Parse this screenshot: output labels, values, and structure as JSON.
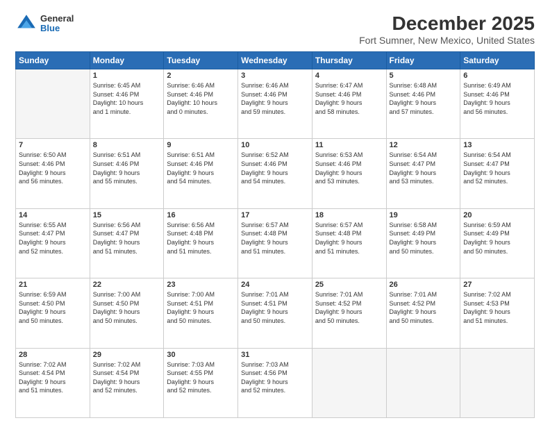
{
  "logo": {
    "general": "General",
    "blue": "Blue"
  },
  "title": "December 2025",
  "subtitle": "Fort Sumner, New Mexico, United States",
  "header": {
    "days": [
      "Sunday",
      "Monday",
      "Tuesday",
      "Wednesday",
      "Thursday",
      "Friday",
      "Saturday"
    ]
  },
  "weeks": [
    [
      {
        "day": "",
        "info": ""
      },
      {
        "day": "1",
        "info": "Sunrise: 6:45 AM\nSunset: 4:46 PM\nDaylight: 10 hours\nand 1 minute."
      },
      {
        "day": "2",
        "info": "Sunrise: 6:46 AM\nSunset: 4:46 PM\nDaylight: 10 hours\nand 0 minutes."
      },
      {
        "day": "3",
        "info": "Sunrise: 6:46 AM\nSunset: 4:46 PM\nDaylight: 9 hours\nand 59 minutes."
      },
      {
        "day": "4",
        "info": "Sunrise: 6:47 AM\nSunset: 4:46 PM\nDaylight: 9 hours\nand 58 minutes."
      },
      {
        "day": "5",
        "info": "Sunrise: 6:48 AM\nSunset: 4:46 PM\nDaylight: 9 hours\nand 57 minutes."
      },
      {
        "day": "6",
        "info": "Sunrise: 6:49 AM\nSunset: 4:46 PM\nDaylight: 9 hours\nand 56 minutes."
      }
    ],
    [
      {
        "day": "7",
        "info": "Sunrise: 6:50 AM\nSunset: 4:46 PM\nDaylight: 9 hours\nand 56 minutes."
      },
      {
        "day": "8",
        "info": "Sunrise: 6:51 AM\nSunset: 4:46 PM\nDaylight: 9 hours\nand 55 minutes."
      },
      {
        "day": "9",
        "info": "Sunrise: 6:51 AM\nSunset: 4:46 PM\nDaylight: 9 hours\nand 54 minutes."
      },
      {
        "day": "10",
        "info": "Sunrise: 6:52 AM\nSunset: 4:46 PM\nDaylight: 9 hours\nand 54 minutes."
      },
      {
        "day": "11",
        "info": "Sunrise: 6:53 AM\nSunset: 4:46 PM\nDaylight: 9 hours\nand 53 minutes."
      },
      {
        "day": "12",
        "info": "Sunrise: 6:54 AM\nSunset: 4:47 PM\nDaylight: 9 hours\nand 53 minutes."
      },
      {
        "day": "13",
        "info": "Sunrise: 6:54 AM\nSunset: 4:47 PM\nDaylight: 9 hours\nand 52 minutes."
      }
    ],
    [
      {
        "day": "14",
        "info": "Sunrise: 6:55 AM\nSunset: 4:47 PM\nDaylight: 9 hours\nand 52 minutes."
      },
      {
        "day": "15",
        "info": "Sunrise: 6:56 AM\nSunset: 4:47 PM\nDaylight: 9 hours\nand 51 minutes."
      },
      {
        "day": "16",
        "info": "Sunrise: 6:56 AM\nSunset: 4:48 PM\nDaylight: 9 hours\nand 51 minutes."
      },
      {
        "day": "17",
        "info": "Sunrise: 6:57 AM\nSunset: 4:48 PM\nDaylight: 9 hours\nand 51 minutes."
      },
      {
        "day": "18",
        "info": "Sunrise: 6:57 AM\nSunset: 4:48 PM\nDaylight: 9 hours\nand 51 minutes."
      },
      {
        "day": "19",
        "info": "Sunrise: 6:58 AM\nSunset: 4:49 PM\nDaylight: 9 hours\nand 50 minutes."
      },
      {
        "day": "20",
        "info": "Sunrise: 6:59 AM\nSunset: 4:49 PM\nDaylight: 9 hours\nand 50 minutes."
      }
    ],
    [
      {
        "day": "21",
        "info": "Sunrise: 6:59 AM\nSunset: 4:50 PM\nDaylight: 9 hours\nand 50 minutes."
      },
      {
        "day": "22",
        "info": "Sunrise: 7:00 AM\nSunset: 4:50 PM\nDaylight: 9 hours\nand 50 minutes."
      },
      {
        "day": "23",
        "info": "Sunrise: 7:00 AM\nSunset: 4:51 PM\nDaylight: 9 hours\nand 50 minutes."
      },
      {
        "day": "24",
        "info": "Sunrise: 7:01 AM\nSunset: 4:51 PM\nDaylight: 9 hours\nand 50 minutes."
      },
      {
        "day": "25",
        "info": "Sunrise: 7:01 AM\nSunset: 4:52 PM\nDaylight: 9 hours\nand 50 minutes."
      },
      {
        "day": "26",
        "info": "Sunrise: 7:01 AM\nSunset: 4:52 PM\nDaylight: 9 hours\nand 50 minutes."
      },
      {
        "day": "27",
        "info": "Sunrise: 7:02 AM\nSunset: 4:53 PM\nDaylight: 9 hours\nand 51 minutes."
      }
    ],
    [
      {
        "day": "28",
        "info": "Sunrise: 7:02 AM\nSunset: 4:54 PM\nDaylight: 9 hours\nand 51 minutes."
      },
      {
        "day": "29",
        "info": "Sunrise: 7:02 AM\nSunset: 4:54 PM\nDaylight: 9 hours\nand 52 minutes."
      },
      {
        "day": "30",
        "info": "Sunrise: 7:03 AM\nSunset: 4:55 PM\nDaylight: 9 hours\nand 52 minutes."
      },
      {
        "day": "31",
        "info": "Sunrise: 7:03 AM\nSunset: 4:56 PM\nDaylight: 9 hours\nand 52 minutes."
      },
      {
        "day": "",
        "info": ""
      },
      {
        "day": "",
        "info": ""
      },
      {
        "day": "",
        "info": ""
      }
    ]
  ]
}
